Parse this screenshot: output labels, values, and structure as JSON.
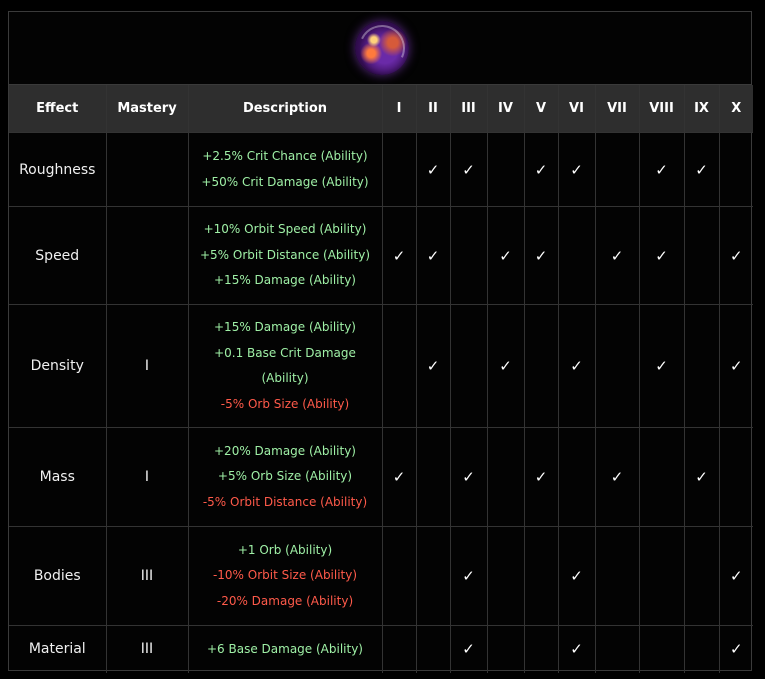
{
  "columns": {
    "effect": "Effect",
    "mastery": "Mastery",
    "description": "Description",
    "tiers": [
      "I",
      "II",
      "III",
      "IV",
      "V",
      "VI",
      "VII",
      "VIII",
      "IX",
      "X"
    ]
  },
  "check_symbol": "✓",
  "rows": [
    {
      "effect": "Roughness",
      "mastery": "",
      "lines": [
        {
          "text": "+2.5% Crit Chance (Ability)",
          "type": "positive"
        },
        {
          "text": "+50% Crit Damage (Ability)",
          "type": "positive"
        }
      ],
      "tiers": [
        false,
        true,
        true,
        false,
        true,
        true,
        false,
        true,
        true,
        false
      ]
    },
    {
      "effect": "Speed",
      "mastery": "",
      "lines": [
        {
          "text": "+10% Orbit Speed (Ability)",
          "type": "positive"
        },
        {
          "text": "+5% Orbit Distance (Ability)",
          "type": "positive"
        },
        {
          "text": "+15% Damage (Ability)",
          "type": "positive"
        }
      ],
      "tiers": [
        true,
        true,
        false,
        true,
        true,
        false,
        true,
        true,
        false,
        true
      ]
    },
    {
      "effect": "Density",
      "mastery": "I",
      "lines": [
        {
          "text": "+15% Damage (Ability)",
          "type": "positive"
        },
        {
          "text": "+0.1 Base Crit Damage (Ability)",
          "type": "positive"
        },
        {
          "text": "-5% Orb Size (Ability)",
          "type": "negative"
        }
      ],
      "tiers": [
        false,
        true,
        false,
        true,
        false,
        true,
        false,
        true,
        false,
        true
      ]
    },
    {
      "effect": "Mass",
      "mastery": "I",
      "lines": [
        {
          "text": "+20% Damage (Ability)",
          "type": "positive"
        },
        {
          "text": "+5% Orb Size (Ability)",
          "type": "positive"
        },
        {
          "text": "-5% Orbit Distance (Ability)",
          "type": "negative"
        }
      ],
      "tiers": [
        true,
        false,
        true,
        false,
        true,
        false,
        true,
        false,
        true,
        false
      ]
    },
    {
      "effect": "Bodies",
      "mastery": "III",
      "lines": [
        {
          "text": "+1 Orb (Ability)",
          "type": "positive"
        },
        {
          "text": "-10% Orbit Size (Ability)",
          "type": "negative"
        },
        {
          "text": "-20% Damage (Ability)",
          "type": "negative"
        }
      ],
      "tiers": [
        false,
        false,
        true,
        false,
        false,
        true,
        false,
        false,
        false,
        true
      ]
    },
    {
      "effect": "Material",
      "mastery": "III",
      "lines": [
        {
          "text": "+6 Base Damage (Ability)",
          "type": "positive"
        }
      ],
      "tiers": [
        false,
        false,
        true,
        false,
        false,
        true,
        false,
        false,
        false,
        true
      ]
    }
  ],
  "colors": {
    "positive": "#9ff0a6",
    "negative": "#ff5a4a",
    "header_bg": "#2e2e2e"
  },
  "banner_icon": "orb-planet-icon"
}
